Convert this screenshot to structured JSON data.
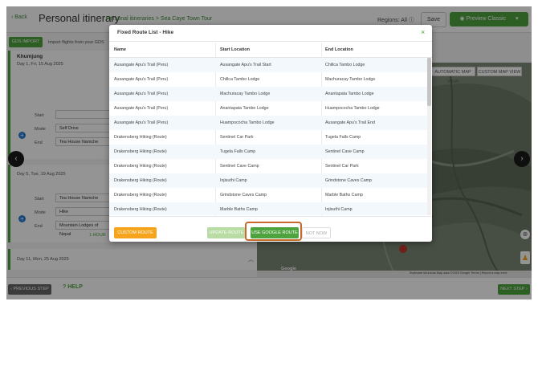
{
  "header": {
    "back_label": "Back",
    "title": "Personal itinerary",
    "breadcrumb": "Personal itineraries > Sea Caye Town Tour",
    "regions": "Regions: All",
    "save_label": "Save",
    "preview_label": "Preview Classic"
  },
  "left_panel": {
    "gds_button": "GDS IMPORT",
    "gds_text": "Import flights from your GDS",
    "day1": {
      "title": "Khumjung",
      "date": "Day 1, Fri, 15 Aug 2025",
      "start_label": "Start",
      "start_value": "",
      "mode_label": "Mode",
      "mode_value": "Self Drive",
      "end_label": "End",
      "end_value": "Tea House Namche"
    },
    "day5": {
      "date": "Day 5, Tue, 19 Aug 2025",
      "start_label": "Start",
      "start_value": "Tea House Namche",
      "mode_label": "Mode",
      "mode_value": "Hike",
      "end_label": "End",
      "end_value": "Mountain Lodges of Nepal",
      "sub_link": "1 HOUR"
    },
    "day11": {
      "date": "Day 11, Mon, 25 Aug 2025"
    }
  },
  "map": {
    "btn_auto": "AUTOMATIC MAP VIEW",
    "btn_custom": "CUSTOM MAP VIEW",
    "footer_text": "Keyboard shortcuts   Map data ©2025 Google   Terms | Report a map error",
    "brand": "Google"
  },
  "bottom_bar": {
    "prev_label": "PREVIOUS STEP",
    "help_label": "HELP",
    "next_label": "NEXT STEP"
  },
  "modal": {
    "title": "Fixed Route List - Hike",
    "close_symbol": "×",
    "col_name": "Name",
    "col_start": "Start Location",
    "col_end": "End Location",
    "rows": [
      {
        "name": "Ausangate Apu's Trail (Peru)",
        "start": "Ausangate Apu's Trail Start",
        "end": "Chillca Tambo Lodge"
      },
      {
        "name": "Ausangate Apu's Trail (Peru)",
        "start": "Chillca Tambo Lodge",
        "end": "Machuracay Tambo Lodge"
      },
      {
        "name": "Ausangate Apu's Trail (Peru)",
        "start": "Machuracay Tambo Lodge",
        "end": "Anantapata Tambo Lodge"
      },
      {
        "name": "Ausangate Apu's Trail (Peru)",
        "start": "Anantapata Tambo Lodge",
        "end": "Huampococha Tambo Lodge"
      },
      {
        "name": "Ausangate Apu's Trail (Peru)",
        "start": "Huampococha Tambo Lodge",
        "end": "Ausangate Apu's Trail End"
      },
      {
        "name": "Drakensberg Hiking (Route)",
        "start": "Sentinel Car Park",
        "end": "Tugela Falls Camp"
      },
      {
        "name": "Drakensberg Hiking (Route)",
        "start": "Tugela Falls Camp",
        "end": "Sentinel Cave Camp"
      },
      {
        "name": "Drakensberg Hiking (Route)",
        "start": "Sentinel Cave Camp",
        "end": "Sentinel Car Park"
      },
      {
        "name": "Drakensberg Hiking (Route)",
        "start": "Injisuthi Camp",
        "end": "Grindstone Caves Camp"
      },
      {
        "name": "Drakensberg Hiking (Route)",
        "start": "Grindstone Caves Camp",
        "end": "Marble Baths Camp"
      },
      {
        "name": "Drakensberg Hiking (Route)",
        "start": "Marble Baths Camp",
        "end": "Injisuthi Camp"
      }
    ],
    "btn_custom": "CUSTOM ROUTE",
    "btn_update": "UPDATE ROUTE",
    "btn_google": "USE GOOGLE ROUTE",
    "btn_notnow": "NOT NOW"
  },
  "colors": {
    "brand_green": "#4fa33f",
    "custom_route_orange": "#f5a41c",
    "highlight_outline": "#c8692b"
  }
}
